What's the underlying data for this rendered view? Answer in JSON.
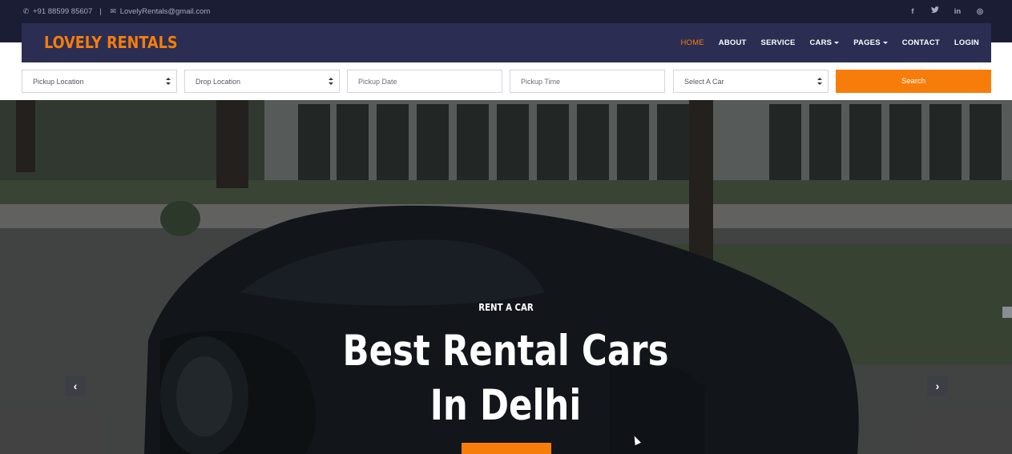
{
  "topbar": {
    "phone": "+91 88599 85607",
    "separator": "|",
    "email": "LovelyRentals@gmail.com",
    "phone_icon": "phone-icon",
    "email_icon": "envelope-icon",
    "social": [
      {
        "icon": "facebook-icon",
        "glyph": "f"
      },
      {
        "icon": "twitter-icon",
        "glyph": "🐦"
      },
      {
        "icon": "linkedin-icon",
        "glyph": "in"
      },
      {
        "icon": "instagram-icon",
        "glyph": "◎"
      }
    ]
  },
  "navbar": {
    "logo": "LOVELY RENTALS",
    "items": [
      {
        "label": "HOME",
        "active": true
      },
      {
        "label": "ABOUT"
      },
      {
        "label": "SERVICE"
      },
      {
        "label": "CARS",
        "dropdown": true
      },
      {
        "label": "PAGES",
        "dropdown": true
      },
      {
        "label": "CONTACT"
      },
      {
        "label": "LOGIN"
      }
    ]
  },
  "search": {
    "pickup_location": "Pickup Location",
    "drop_location": "Drop Location",
    "pickup_date_placeholder": "Pickup Date",
    "pickup_time_placeholder": "Pickup Time",
    "select_car": "Select A Car",
    "button_label": "Search"
  },
  "hero": {
    "kicker": "RENT A CAR",
    "headline": "Best Rental Cars In Delhi",
    "prev_glyph": "‹",
    "next_glyph": "›"
  },
  "colors": {
    "accent": "#f77d0a",
    "topbar_bg": "#1b1d35",
    "navbar_bg": "#2b2e52"
  }
}
